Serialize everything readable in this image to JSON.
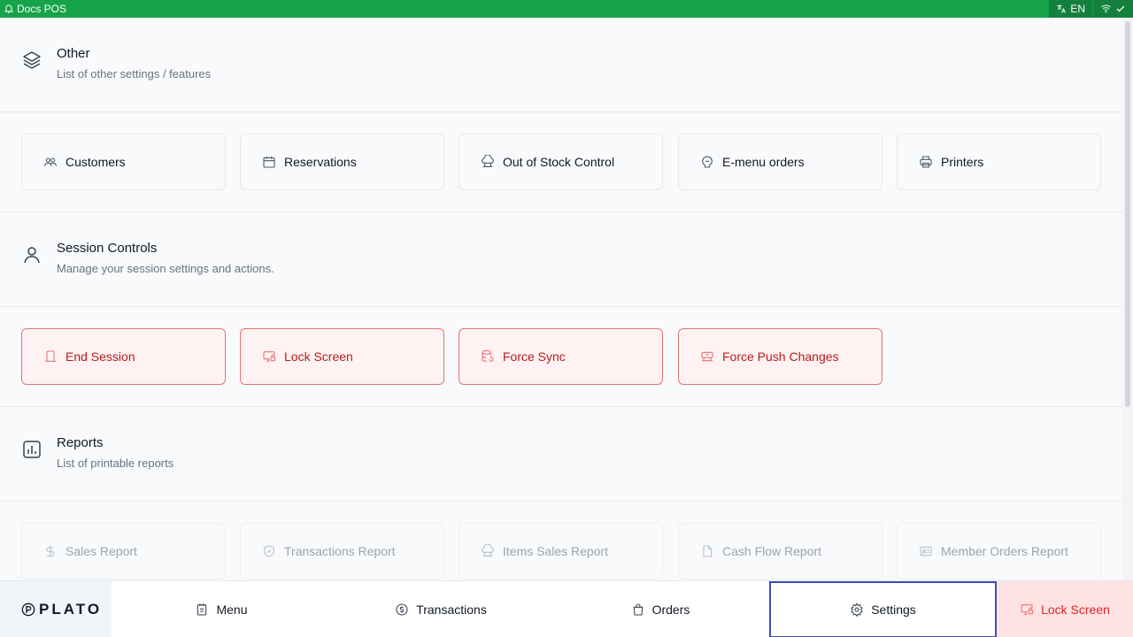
{
  "titlebar": {
    "app_name": "Docs POS",
    "language": "EN"
  },
  "sections": {
    "other": {
      "title": "Other",
      "subtitle": "List of other settings / features",
      "icon": "layers-icon"
    },
    "session": {
      "title": "Session Controls",
      "subtitle": "Manage your session settings and actions.",
      "icon": "user-icon"
    },
    "reports": {
      "title": "Reports",
      "subtitle": "List of printable reports",
      "icon": "bar-chart-icon"
    }
  },
  "other_items": [
    {
      "label": "Customers",
      "icon": "users-icon"
    },
    {
      "label": "Reservations",
      "icon": "calendar-icon"
    },
    {
      "label": "Out of Stock Control",
      "icon": "chef-icon"
    },
    {
      "label": "E-menu orders",
      "icon": "emenu-icon"
    },
    {
      "label": "Printers",
      "icon": "printer-icon"
    }
  ],
  "session_items": [
    {
      "label": "End Session",
      "icon": "exit-icon"
    },
    {
      "label": "Lock Screen",
      "icon": "monitor-lock-icon"
    },
    {
      "label": "Force Sync",
      "icon": "database-sync-icon"
    },
    {
      "label": "Force Push Changes",
      "icon": "push-icon"
    }
  ],
  "report_items": [
    {
      "label": "Sales Report",
      "icon": "dollar-icon"
    },
    {
      "label": "Transactions Report",
      "icon": "shield-check-icon"
    },
    {
      "label": "Items Sales Report",
      "icon": "chef-icon"
    },
    {
      "label": "Cash Flow Report",
      "icon": "file-icon"
    },
    {
      "label": "Member Orders Report",
      "icon": "id-card-icon"
    }
  ],
  "nav": {
    "logo": "PLATO",
    "items": [
      {
        "label": "Menu",
        "icon": "menu-book-icon"
      },
      {
        "label": "Transactions",
        "icon": "coin-icon"
      },
      {
        "label": "Orders",
        "icon": "bag-icon"
      },
      {
        "label": "Settings",
        "icon": "gear-icon"
      },
      {
        "label": "Lock Screen",
        "icon": "monitor-lock-icon"
      }
    ]
  },
  "colors": {
    "topbar": "#16a34a",
    "danger": "#e57373",
    "active_outline": "#3b4fb8"
  }
}
